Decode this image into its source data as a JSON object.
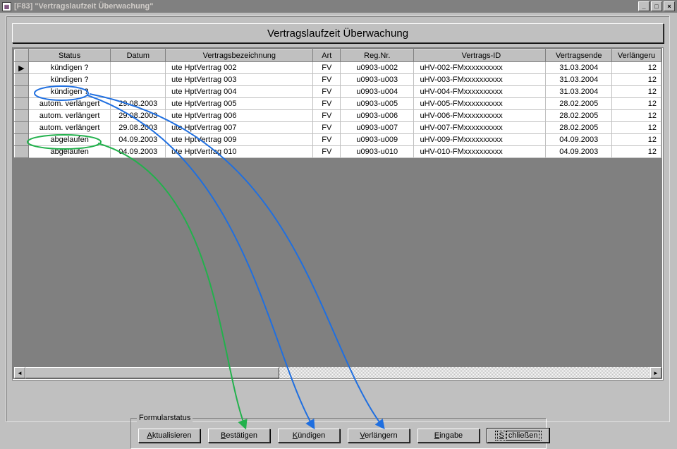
{
  "window": {
    "title": "[F83]  \"Vertragslaufzeit Überwachung\""
  },
  "heading": "Vertragslaufzeit Überwachung",
  "grid": {
    "columns": {
      "status": "Status",
      "datum": "Datum",
      "bezeichnung": "Vertragsbezeichnung",
      "art": "Art",
      "regnr": "Reg.Nr.",
      "vertragsid": "Vertrags-ID",
      "vertragsende": "Vertragsende",
      "verlaengerung": "Verlängeru"
    },
    "rows": [
      {
        "status": "kündigen ?",
        "datum": "",
        "bez": "ute HptVertrag 002",
        "art": "FV",
        "reg": "u0903-u002",
        "id": "uHV-002-FMxxxxxxxxxx",
        "ende": "31.03.2004",
        "verl": "12"
      },
      {
        "status": "kündigen ?",
        "datum": "",
        "bez": "ute HptVertrag 003",
        "art": "FV",
        "reg": "u0903-u003",
        "id": "uHV-003-FMxxxxxxxxxx",
        "ende": "31.03.2004",
        "verl": "12"
      },
      {
        "status": "kündigen ?",
        "datum": "",
        "bez": "ute HptVertrag 004",
        "art": "FV",
        "reg": "u0903-u004",
        "id": "uHV-004-FMxxxxxxxxxx",
        "ende": "31.03.2004",
        "verl": "12"
      },
      {
        "status": "autom. verlängert",
        "datum": "29.08.2003",
        "bez": "ute HptVertrag 005",
        "art": "FV",
        "reg": "u0903-u005",
        "id": "uHV-005-FMxxxxxxxxxx",
        "ende": "28.02.2005",
        "verl": "12"
      },
      {
        "status": "autom. verlängert",
        "datum": "29.08.2003",
        "bez": "ute HptVertrag 006",
        "art": "FV",
        "reg": "u0903-u006",
        "id": "uHV-006-FMxxxxxxxxxx",
        "ende": "28.02.2005",
        "verl": "12"
      },
      {
        "status": "autom. verlängert",
        "datum": "29.08.2003",
        "bez": "ute HptVertrag 007",
        "art": "FV",
        "reg": "u0903-u007",
        "id": "uHV-007-FMxxxxxxxxxx",
        "ende": "28.02.2005",
        "verl": "12"
      },
      {
        "status": "abgelaufen",
        "datum": "04.09.2003",
        "bez": "ute HptVertrag 009",
        "art": "FV",
        "reg": "u0903-u009",
        "id": "uHV-009-FMxxxxxxxxxx",
        "ende": "04.09.2003",
        "verl": "12"
      },
      {
        "status": "abgelaufen",
        "datum": "04.09.2003",
        "bez": "ute HptVertrag 010",
        "art": "FV",
        "reg": "u0903-u010",
        "id": "uHV-010-FMxxxxxxxxxx",
        "ende": "04.09.2003",
        "verl": "12"
      }
    ]
  },
  "formbox": {
    "legend": "Formularstatus",
    "buttons": {
      "aktualisieren": "Aktualisieren",
      "bestaetigen": "Bestätigen",
      "kuendigen": "Kündigen",
      "verlaengern": "Verlängern",
      "eingabe": "Eingabe",
      "schliessen": "Schließen"
    }
  },
  "annotations": {
    "circle_blue": {
      "target_row": 1,
      "points_to_button": "kuendigen"
    },
    "circle_green": {
      "target_row": 5,
      "points_to_button": "bestaetigen"
    },
    "extra_blue_arrow": {
      "from_row": 1,
      "points_to_button": "verlaengern"
    }
  }
}
